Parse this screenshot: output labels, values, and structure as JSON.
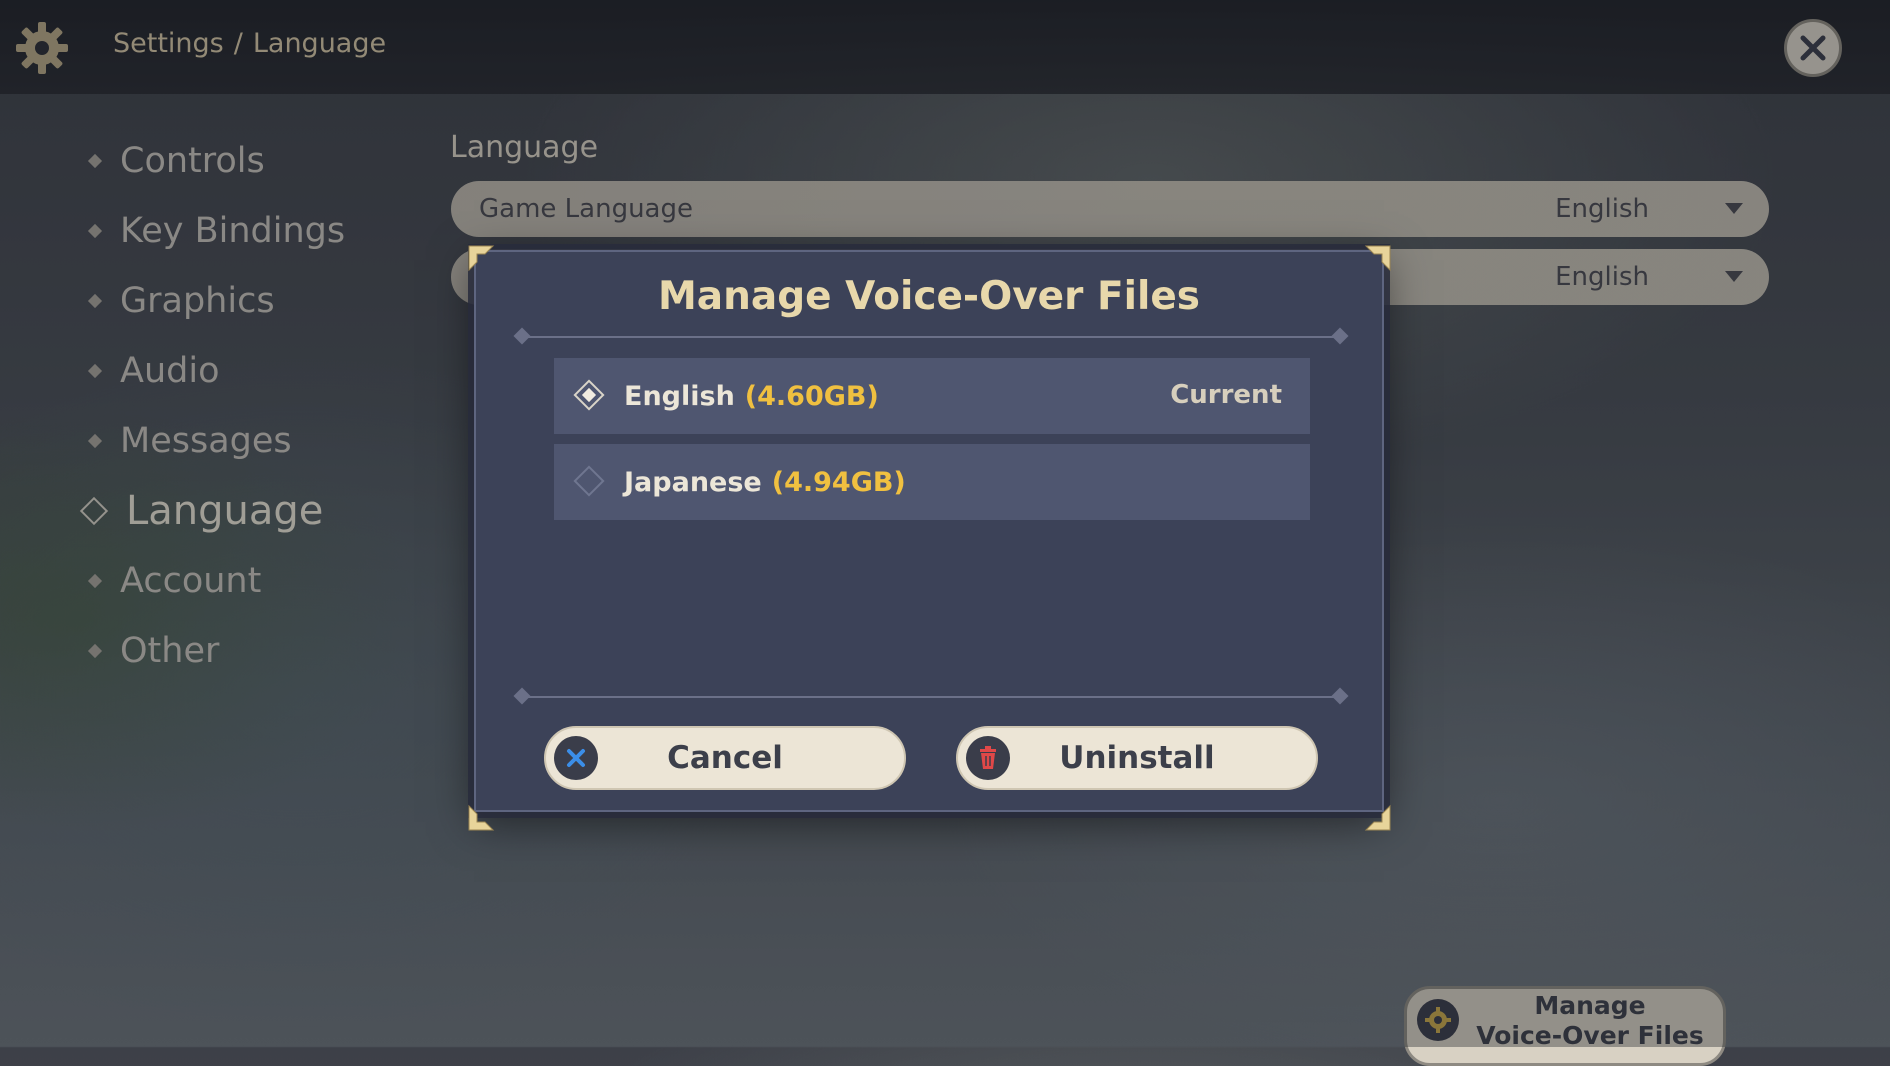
{
  "header": {
    "breadcrumb_root": "Settings",
    "breadcrumb_sep": "/",
    "breadcrumb_current": "Language",
    "icons": {
      "settings": "gear-icon",
      "close": "close-icon"
    }
  },
  "sidebar": {
    "items": [
      {
        "label": "Controls"
      },
      {
        "label": "Key Bindings"
      },
      {
        "label": "Graphics"
      },
      {
        "label": "Audio"
      },
      {
        "label": "Messages"
      },
      {
        "label": "Language",
        "active": true
      },
      {
        "label": "Account"
      },
      {
        "label": "Other"
      }
    ]
  },
  "main": {
    "section_title": "Language",
    "rows": [
      {
        "label": "Game Language",
        "value": "English"
      },
      {
        "label": "",
        "value": "English"
      }
    ]
  },
  "dialog": {
    "title": "Manage Voice-Over Files",
    "options": [
      {
        "name": "English",
        "size": "(4.60GB)",
        "status": "Current",
        "selected": true
      },
      {
        "name": "Japanese",
        "size": "(4.94GB)",
        "status": "",
        "selected": false
      }
    ],
    "cancel_label": "Cancel",
    "uninstall_label": "Uninstall",
    "icons": {
      "cancel": "x-icon",
      "uninstall": "trash-icon"
    }
  },
  "footer": {
    "manage_line1": "Manage",
    "manage_line2": "Voice-Over Files"
  },
  "colors": {
    "accent_gold": "#f0c040",
    "title_gold": "#e8d8ab",
    "dialog_bg": "#3c4258",
    "button_bg": "#ece5d6",
    "cancel_icon": "#3b8ee8",
    "trash_icon": "#e04848"
  }
}
